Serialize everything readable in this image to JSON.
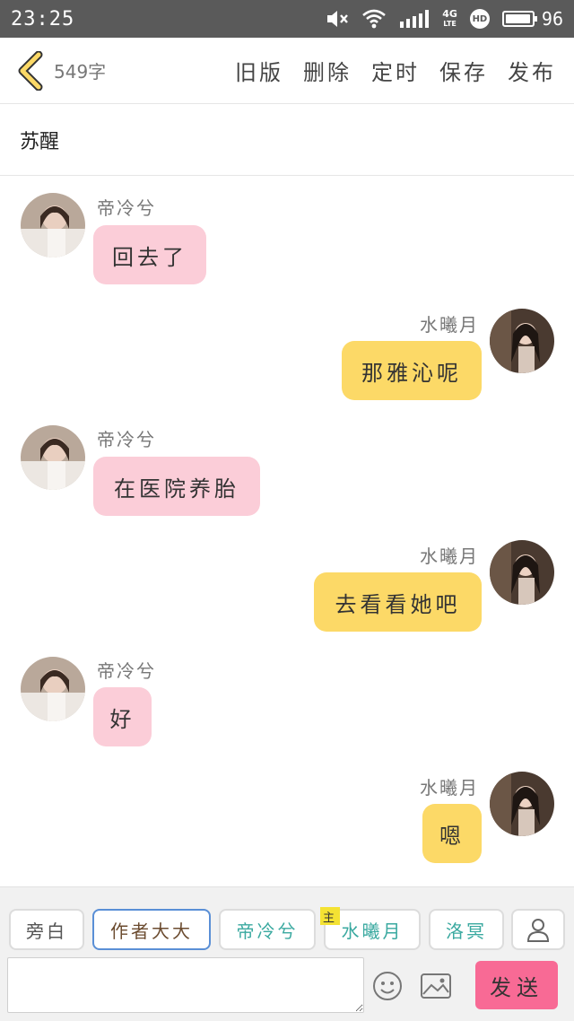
{
  "status_bar": {
    "time": "23:25",
    "network_top": "4G",
    "network_bottom": "LTE",
    "hd_label": "HD",
    "battery_level": "96"
  },
  "header": {
    "word_count": "549字",
    "actions": [
      "旧版",
      "删除",
      "定时",
      "保存",
      "发布"
    ]
  },
  "story": {
    "title": "苏醒"
  },
  "messages": [
    {
      "side": "left",
      "name": "帝冷兮",
      "text": "回去了",
      "bubble_color": "#fbcdd8"
    },
    {
      "side": "right",
      "name": "水曦月",
      "text": "那雅沁呢",
      "bubble_color": "#fcd967"
    },
    {
      "side": "left",
      "name": "帝冷兮",
      "text": "在医院养胎",
      "bubble_color": "#fbcdd8"
    },
    {
      "side": "right",
      "name": "水曦月",
      "text": "去看看她吧",
      "bubble_color": "#fcd967"
    },
    {
      "side": "left",
      "name": "帝冷兮",
      "text": "好",
      "bubble_color": "#fbcdd8"
    },
    {
      "side": "right",
      "name": "水曦月",
      "text": "嗯",
      "bubble_color": "#fcd967"
    }
  ],
  "roles": {
    "narration": "旁白",
    "author": "作者大大",
    "char1": "帝冷兮",
    "char2": "水曦月",
    "char2_tag": "主",
    "char3": "洛冥"
  },
  "composer": {
    "placeholder": "",
    "send_label": "发送"
  },
  "icons": {
    "back": "chevron-left-icon",
    "mute": "speaker-mute-icon",
    "wifi": "wifi-icon",
    "signal": "signal-bars-icon",
    "emoji": "smiley-icon",
    "image": "image-icon",
    "add_role": "person-icon"
  },
  "colors": {
    "accent_yellow": "#fcd967",
    "pink_bubble": "#fbcdd8",
    "send_button": "#f86a95",
    "role_teal": "#3aa9a0",
    "author_border": "#5a8fd6"
  }
}
